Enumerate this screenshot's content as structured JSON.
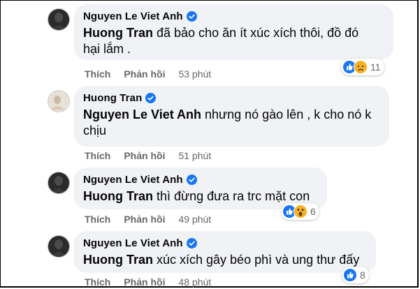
{
  "comments": [
    {
      "author": "Nguyen Le Viet Anh",
      "mention": "Huong Tran",
      "text_line1": " đã bảo cho ăn ít xúc xích thôi, đồ đó",
      "text_line2": "hại lắm .",
      "like_label": "Thích",
      "reply_label": "Phản hồi",
      "time": "53 phút",
      "reactions": [
        "like-icon",
        "sad-icon"
      ],
      "reaction_count": "11"
    },
    {
      "author": "Huong Tran",
      "mention": "Nguyen Le Viet Anh",
      "text_line1": " nhưng nó gào lên , k cho nó k",
      "text_line2": "chịu",
      "like_label": "Thích",
      "reply_label": "Phản hồi",
      "time": "51 phút"
    },
    {
      "author": "Nguyen Le Viet Anh",
      "mention": "Huong Tran",
      "text_line1": " thì đừng đưa ra trc mặt con",
      "like_label": "Thích",
      "reply_label": "Phản hồi",
      "time": "49 phút",
      "reactions": [
        "like-icon",
        "wow-icon"
      ],
      "reaction_count": "6"
    },
    {
      "author": "Nguyen Le Viet Anh",
      "mention": "Huong Tran",
      "text_line1": " xúc xích gây béo phì và ung thư đấy",
      "like_label": "Thích",
      "reply_label": "Phản hồi",
      "time": "48 phút",
      "reactions": [
        "like-icon"
      ],
      "reaction_count": "8"
    }
  ],
  "colors": {
    "bubble": "#f0f2f5",
    "verified": "#1877f2",
    "meta_text": "#65676b",
    "primary_text": "#050505"
  }
}
